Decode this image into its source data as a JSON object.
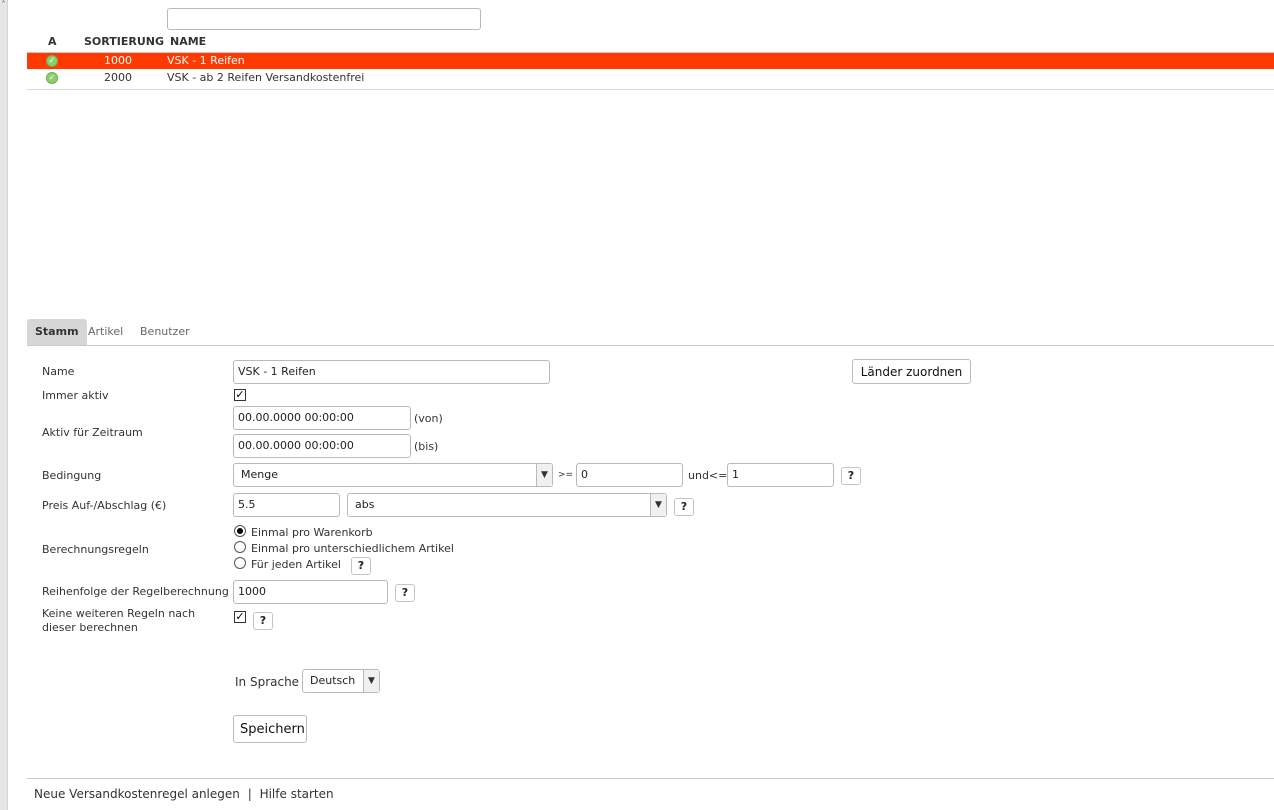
{
  "filter": {
    "value": ""
  },
  "list": {
    "headers": {
      "active": "A",
      "sort": "SORTIERUNG",
      "name": "NAME"
    },
    "rows": [
      {
        "sort": "1000",
        "name": "VSK - 1 Reifen",
        "selected": true
      },
      {
        "sort": "2000",
        "name": "VSK - ab 2 Reifen Versandkostenfrei",
        "selected": false
      }
    ]
  },
  "tabs": [
    "Stamm",
    "Artikel",
    "Benutzer"
  ],
  "form": {
    "name_label": "Name",
    "name_value": "VSK - 1 Reifen",
    "assign_countries": "Länder zuordnen",
    "always_active_label": "Immer aktiv",
    "period_label": "Aktiv für Zeitraum",
    "from_value": "00.00.0000 00:00:00",
    "from_suffix": "(von)",
    "to_value": "00.00.0000 00:00:00",
    "to_suffix": "(bis)",
    "condition_label": "Bedingung",
    "condition_value": "Menge",
    "ge": ">=",
    "ge_value": "0",
    "le": "und<=",
    "le_value": "1",
    "price_label": "Preis Auf-/Abschlag (€)",
    "price_value": "5.5",
    "price_type": "abs",
    "calc_label": "Berechnungsregeln",
    "calc_options": [
      "Einmal pro Warenkorb",
      "Einmal pro unterschiedlichem Artikel",
      "Für jeden Artikel"
    ],
    "order_label": "Reihenfolge der Regelberechnung",
    "order_value": "1000",
    "nomore_label1": "Keine weiteren Regeln nach",
    "nomore_label2": "dieser berechnen",
    "lang_label": "In Sprache",
    "lang_value": "Deutsch",
    "save": "Speichern",
    "help": "?",
    "check": "✓"
  },
  "footer": {
    "new_rule": "Neue Versandkostenregel anlegen",
    "sep": "|",
    "help": "Hilfe starten"
  },
  "colors": {
    "selected_row": "#ff3a00",
    "active_icon": "#8ccf6b"
  }
}
